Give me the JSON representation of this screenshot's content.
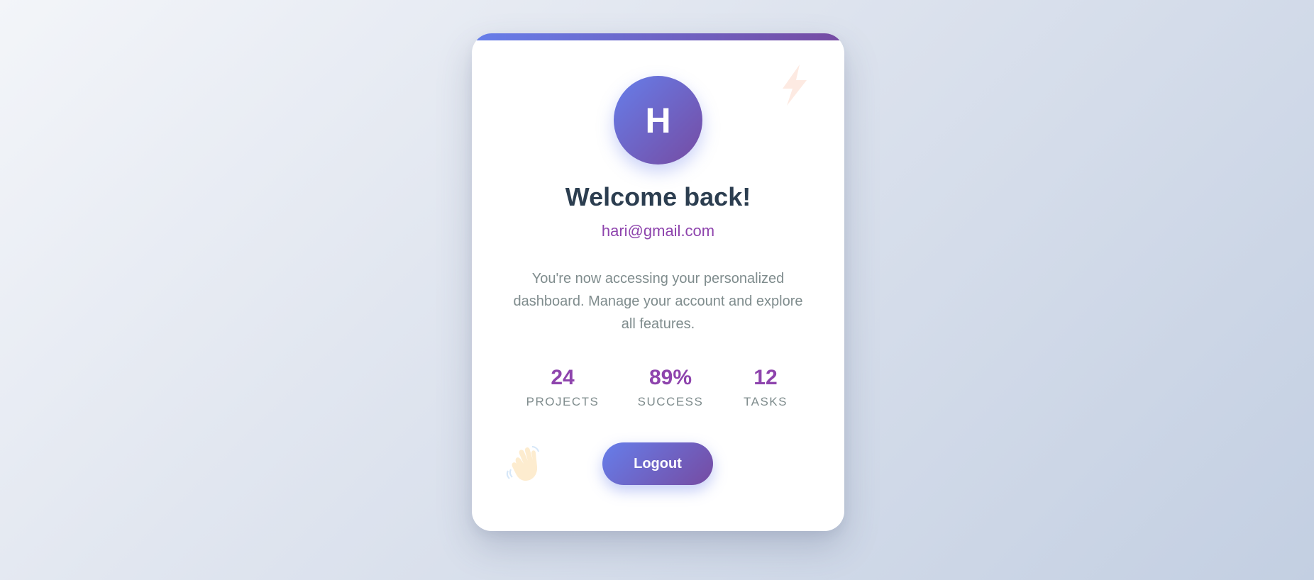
{
  "card": {
    "avatar_initial": "H",
    "title": "Welcome back!",
    "email": "hari@gmail.com",
    "description": "You're now accessing your personalized dashboard. Manage your account and explore all features.",
    "stats": [
      {
        "value": "24",
        "label": "Projects"
      },
      {
        "value": "89%",
        "label": "Success"
      },
      {
        "value": "12",
        "label": "Tasks"
      }
    ],
    "logout_label": "Logout"
  },
  "decorations": {
    "top_right_icon": "lightning-bolt-icon",
    "bottom_left_icon": "waving-hand-icon"
  },
  "colors": {
    "accent_start": "#667eea",
    "accent_end": "#764ba2",
    "heading": "#2c3e50",
    "highlight": "#8e44ad",
    "muted": "#7f8c8d"
  }
}
